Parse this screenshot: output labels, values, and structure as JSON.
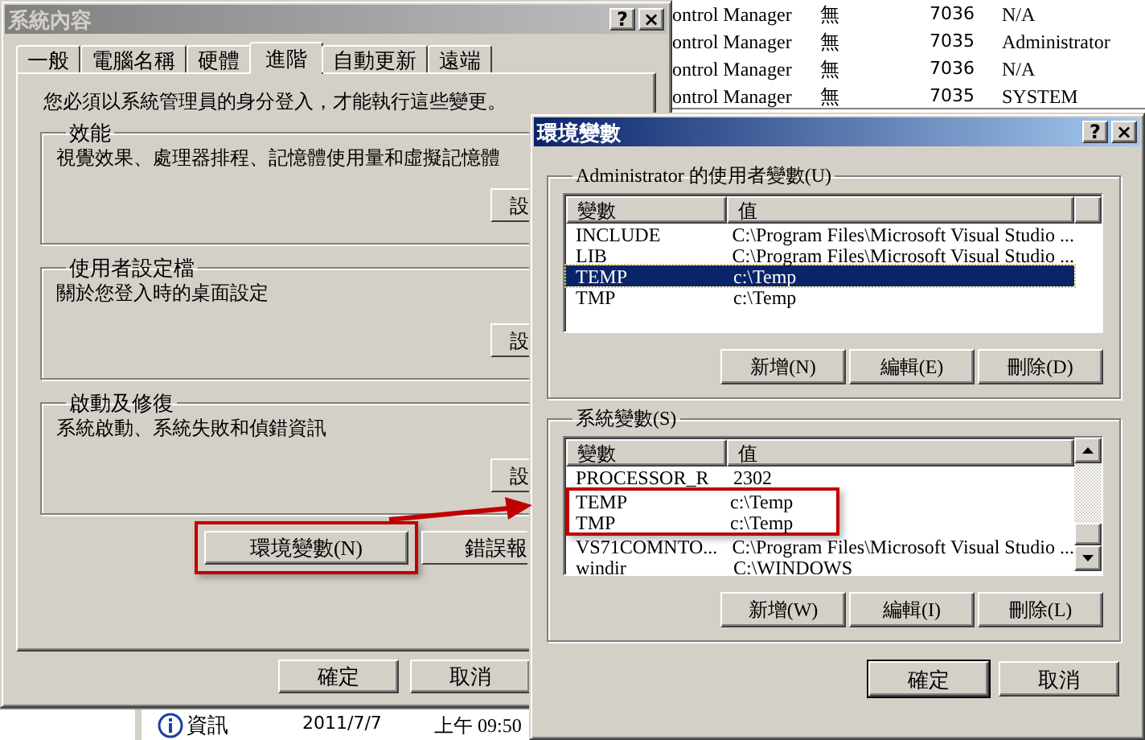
{
  "event_list": {
    "rows": [
      {
        "source": "ontrol Manager",
        "category": "無",
        "event_id": "7036",
        "user": "N/A"
      },
      {
        "source": "ontrol Manager",
        "category": "無",
        "event_id": "7035",
        "user": "Administrator"
      },
      {
        "source": "ontrol Manager",
        "category": "無",
        "event_id": "7036",
        "user": "N/A"
      },
      {
        "source": "ontrol Manager",
        "category": "無",
        "event_id": "7035",
        "user": "SYSTEM"
      }
    ]
  },
  "event_row": {
    "type": "資訊",
    "date": "2011/7/7",
    "time": "上午 09:50"
  },
  "system_properties": {
    "title": "系統內容",
    "active": false,
    "title_buttons": [
      "?",
      "×"
    ],
    "tabs": [
      {
        "label": "一般",
        "selected": false
      },
      {
        "label": "電腦名稱",
        "selected": false
      },
      {
        "label": "硬體",
        "selected": false
      },
      {
        "label": "進階",
        "selected": true
      },
      {
        "label": "自動更新",
        "selected": false
      },
      {
        "label": "遠端",
        "selected": false
      }
    ],
    "notice": "您必須以系統管理員的身分登入，才能執行這些變更。",
    "groups": [
      {
        "title": "效能",
        "description": "視覺效果、處理器排程、記憶體使用量和虛擬記憶體",
        "button": "設"
      },
      {
        "title": "使用者設定檔",
        "description": "關於您登入時的桌面設定",
        "button": "設"
      },
      {
        "title": "啟動及修復",
        "description": "系統啟動、系統失敗和偵錯資訊",
        "button": "設"
      }
    ],
    "buttons": [
      {
        "label": "環境變數(N)",
        "highlighted": true
      },
      {
        "label": "錯誤報",
        "highlighted": false
      }
    ],
    "footer_buttons": [
      "確定",
      "取消"
    ]
  },
  "environment_variables": {
    "title": "環境變數",
    "active": true,
    "title_buttons": [
      "?",
      "×"
    ],
    "user_variables": {
      "title": "Administrator 的使用者變數(U)",
      "columns": [
        "變數",
        "值"
      ],
      "rows": [
        {
          "name": "INCLUDE",
          "value": "C:\\Program Files\\Microsoft Visual Studio ...",
          "selected": false,
          "highlighted": false
        },
        {
          "name": "LIB",
          "value": "C:\\Program Files\\Microsoft Visual Studio ...",
          "selected": false,
          "highlighted": false
        },
        {
          "name": "TEMP",
          "value": "c:\\Temp",
          "selected": true,
          "highlighted": false
        },
        {
          "name": "TMP",
          "value": "c:\\Temp",
          "selected": false,
          "highlighted": false
        }
      ],
      "buttons": [
        "新增(N)",
        "編輯(E)",
        "刪除(D)"
      ]
    },
    "system_variables": {
      "title": "系統變數(S)",
      "columns": [
        "變數",
        "值"
      ],
      "rows": [
        {
          "name": "PROCESSOR_R",
          "value": "2302",
          "selected": false,
          "highlighted": false
        },
        {
          "name": "TEMP",
          "value": "c:\\Temp",
          "selected": false,
          "highlighted": true
        },
        {
          "name": "TMP",
          "value": "c:\\Temp",
          "selected": false,
          "highlighted": true
        },
        {
          "name": "VS71COMNTO...",
          "value": "C:\\Program Files\\Microsoft Visual Studio ...",
          "selected": false,
          "highlighted": false
        },
        {
          "name": "windir",
          "value": "C:\\WINDOWS",
          "selected": false,
          "highlighted": false
        }
      ],
      "buttons": [
        "新增(W)",
        "編輯(I)",
        "刪除(L)"
      ]
    },
    "footer_buttons": [
      {
        "label": "確定",
        "default": true
      },
      {
        "label": "取消",
        "default": false
      }
    ]
  }
}
